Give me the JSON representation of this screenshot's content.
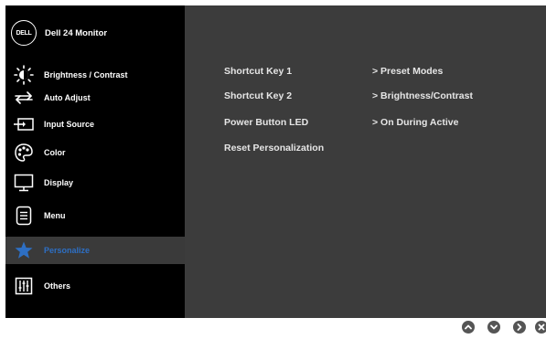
{
  "brand": {
    "logo_text": "DELL",
    "title": "Dell 24 Monitor"
  },
  "sidebar": {
    "items": [
      {
        "label": "Brightness / Contrast",
        "icon": "brightness-icon"
      },
      {
        "label": "Auto Adjust",
        "icon": "auto-adjust-icon"
      },
      {
        "label": "Input Source",
        "icon": "input-source-icon"
      },
      {
        "label": "Color",
        "icon": "color-palette-icon"
      },
      {
        "label": "Display",
        "icon": "display-monitor-icon"
      },
      {
        "label": "Menu",
        "icon": "menu-icon"
      },
      {
        "label": "Personalize",
        "icon": "star-icon",
        "active": true
      },
      {
        "label": "Others",
        "icon": "others-sliders-icon"
      }
    ]
  },
  "main": {
    "rows": [
      {
        "key": "Shortcut Key 1",
        "value": ">  Preset Modes"
      },
      {
        "key": "Shortcut Key 2",
        "value": ">  Brightness/Contrast"
      },
      {
        "key": "Power Button LED",
        "value": ">  On During Active"
      },
      {
        "key": "Reset Personalization",
        "value": ""
      }
    ]
  },
  "nav": {
    "buttons": [
      "up-arrow-icon",
      "down-arrow-icon",
      "right-arrow-icon",
      "close-icon"
    ]
  },
  "colors": {
    "active_label": "#2d6fc4",
    "active_bg": "#3a3a3a",
    "main_bg": "#3c3c3c",
    "sidebar_bg": "#000000"
  }
}
